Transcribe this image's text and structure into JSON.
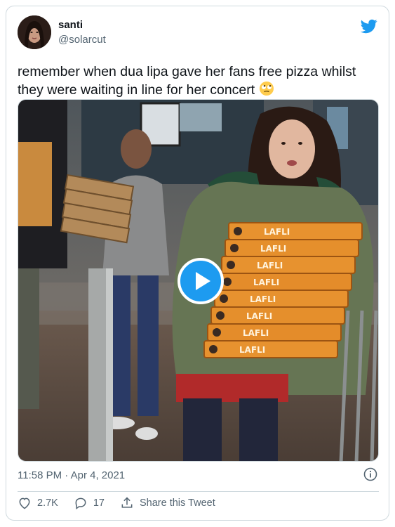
{
  "tweet": {
    "display_name": "santi",
    "handle": "@solarcut",
    "text": "remember when dua lipa gave her fans free pizza whilst they were waiting in line for her concert",
    "emoji": "rolling-eyes-face-emoji",
    "timestamp": "11:58 PM · Apr 4, 2021",
    "likes": "2.7K",
    "replies": "17",
    "share_label": "Share this Tweet"
  },
  "media": {
    "type": "video",
    "pizza_box_text": "LAFLI"
  },
  "colors": {
    "accent": "#1d9bf0",
    "secondary_text": "#536471",
    "border": "#cfd9de"
  },
  "icons": [
    "twitter-bird-icon",
    "play-icon",
    "info-icon",
    "heart-icon",
    "reply-icon",
    "share-icon"
  ]
}
